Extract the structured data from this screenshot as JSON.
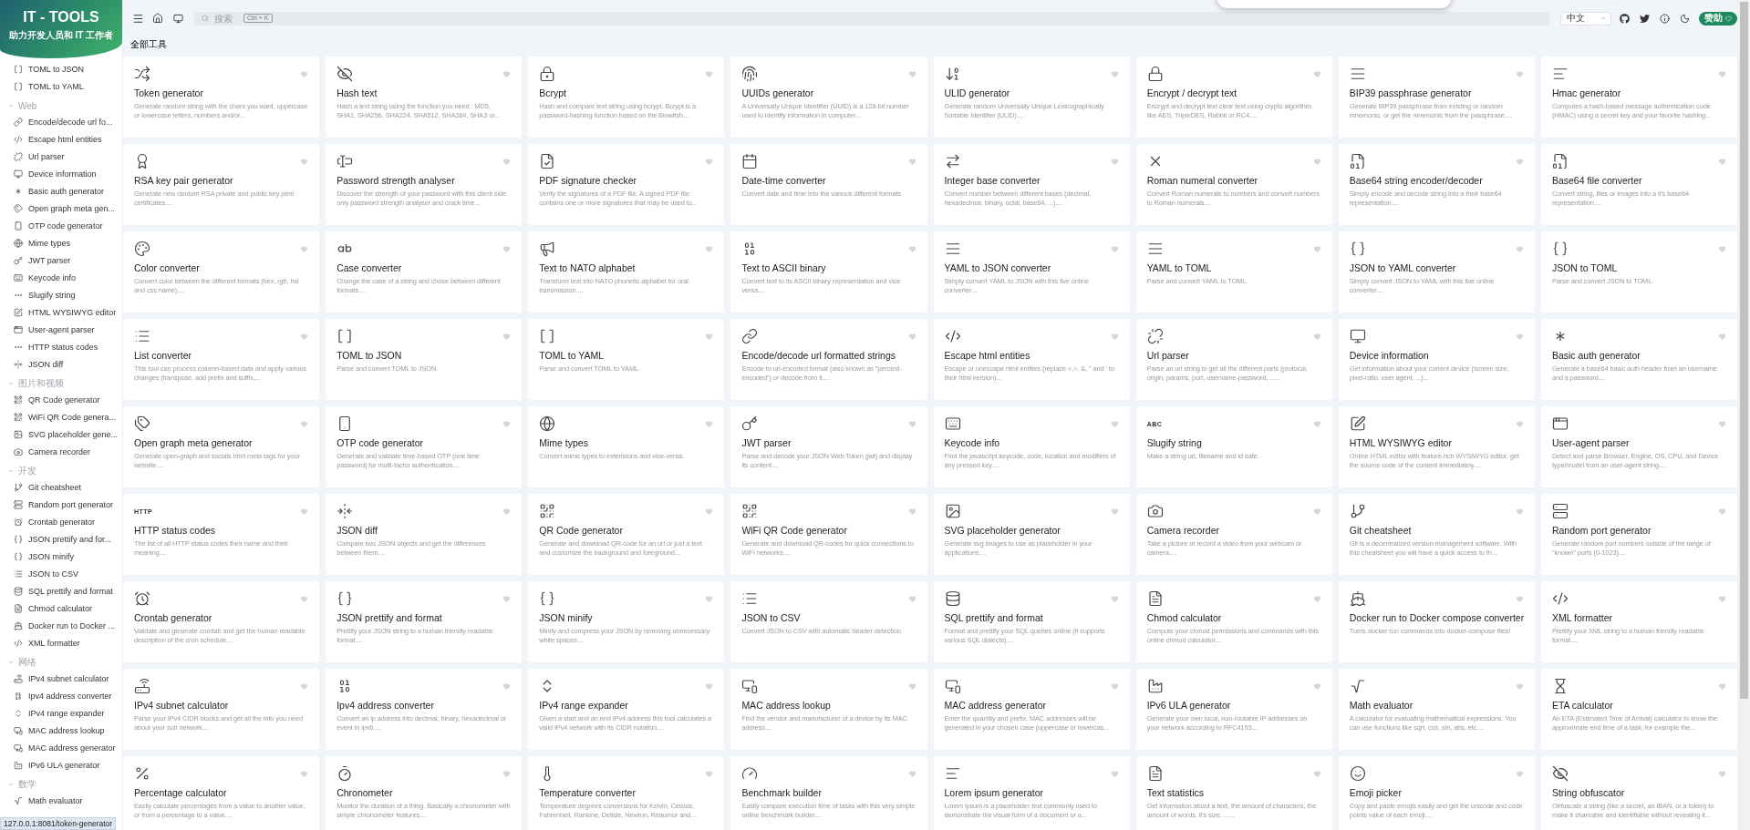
{
  "sidebar": {
    "logo": {
      "title": "IT - TOOLS",
      "subtitle": "助力开发人员和 IT 工作者"
    },
    "groups": [
      {
        "items": [
          "TOML to JSON",
          "TOML to YAML"
        ]
      },
      {
        "label": "Web",
        "expanded": true,
        "items": [
          "Encode/decode url fo...",
          "Escape html entities",
          "Url parser",
          "Device information",
          "Basic auth generator",
          "Open graph meta gen...",
          "OTP code generator",
          "Mime types",
          "JWT parser",
          "Keycode info",
          "Slugify string",
          "HTML WYSIWYG editor",
          "User-agent parser",
          "HTTP status codes",
          "JSON diff"
        ]
      },
      {
        "label": "图片和视频",
        "expanded": true,
        "items": [
          "QR Code generator",
          "WiFi QR Code genera...",
          "SVG placeholder gene...",
          "Camera recorder"
        ]
      },
      {
        "label": "开发",
        "expanded": true,
        "items": [
          "Git cheatsheet",
          "Random port generator",
          "Crontab generator",
          "JSON prettify and for...",
          "JSON minify",
          "JSON to CSV",
          "SQL prettify and format",
          "Chmod calculator",
          "Docker run to Docker ...",
          "XML formatter"
        ]
      },
      {
        "label": "网络",
        "expanded": true,
        "items": [
          "IPv4 subnet calculator",
          "Ipv4 address converter",
          "IPv4 range expander",
          "MAC address lookup",
          "MAC address generator",
          "IPv6 ULA generator"
        ]
      },
      {
        "label": "数学",
        "expanded": true,
        "items": [
          "Math evaluator"
        ]
      }
    ]
  },
  "topbar": {
    "search": {
      "placeholder": "搜索",
      "shortcut": "Ctrl + K"
    },
    "language": "中文",
    "sponsor": "赞助"
  },
  "section_title": "全部工具",
  "cards": [
    {
      "title": "Token generator",
      "description": "Generate random string with the chars you want, uppercase or lowercase letters, numbers and/or..."
    },
    {
      "title": "Hash text",
      "description": "Hash a text string using the function you need : MD5, SHA1, SHA256, SHA224, SHA512, SHA384, SHA3 or..."
    },
    {
      "title": "Bcrypt",
      "description": "Hash and compare text string using bcrypt. Bcrypt is a password-hashing function based on the Blowfish..."
    },
    {
      "title": "UUIDs generator",
      "description": "A Universally Unique Identifier (UUID) is a 128-bit number used to identify information in computer..."
    },
    {
      "title": "ULID generator",
      "description": "Generate random Universally Unique Lexicographically Sortable Identifier (ULID)...."
    },
    {
      "title": "Encrypt / decrypt text",
      "description": "Encrypt and decrypt text clear text using crypto algorithm like AES, TripleDES, Rabbit or RC4...."
    },
    {
      "title": "BIP39 passphrase generator",
      "description": "Generate BIP39 passphrase from existing or random mnemonic, or get the mnemonic from the passphrase...."
    },
    {
      "title": "Hmac generator",
      "description": "Computes a hash-based message authentication code (HMAC) using a secret key and your favorite hashing..."
    },
    {
      "title": "RSA key pair generator",
      "description": "Generate new random RSA private and public key pem certificates...."
    },
    {
      "title": "Password strength analyser",
      "description": "Discover the strength of your password with this client side only password strength analyser and crack time..."
    },
    {
      "title": "PDF signature checker",
      "description": "Verify the signatures of a PDF file. A signed PDF file contains one or more signatures that may be used to..."
    },
    {
      "title": "Date-time converter",
      "description": "Convert date and time into the various different formats"
    },
    {
      "title": "Integer base converter",
      "description": "Convert number between different bases (decimal, hexadecimal, binary, octal, base64, ...)...."
    },
    {
      "title": "Roman numeral converter",
      "description": "Convert Roman numerals to numbers and convert numbers to Roman numerals...."
    },
    {
      "title": "Base64 string encoder/decoder",
      "description": "Simply encode and decode string into a their base64 representation...."
    },
    {
      "title": "Base64 file converter",
      "description": "Convert string, files or images into a it's base64 representation...."
    },
    {
      "title": "Color converter",
      "description": "Convert color between the different formats (hex, rgb, hsl and css name)...."
    },
    {
      "title": "Case converter",
      "description": "Change the case of a string and chose between different formats...."
    },
    {
      "title": "Text to NATO alphabet",
      "description": "Transform text into NATO phonetic alphabet for oral transmission...."
    },
    {
      "title": "Text to ASCII binary",
      "description": "Convert text to its ASCII binary representation and vice versa...."
    },
    {
      "title": "YAML to JSON converter",
      "description": "Simply convert YAML to JSON with this live online converter...."
    },
    {
      "title": "YAML to TOML",
      "description": "Parse and convert YAML to TOML."
    },
    {
      "title": "JSON to YAML converter",
      "description": "Simply convert JSON to YAML with this live online converter...."
    },
    {
      "title": "JSON to TOML",
      "description": "Parse and convert JSON to TOML."
    },
    {
      "title": "List converter",
      "description": "This tool can process column-based data and apply various changes (transpose, add prefix and suffix,..."
    },
    {
      "title": "TOML to JSON",
      "description": "Parse and convert TOML to JSON."
    },
    {
      "title": "TOML to YAML",
      "description": "Parse and convert TOML to YAML."
    },
    {
      "title": "Encode/decode url formatted strings",
      "description": "Encode to url-encoded format (also known as \"percent-encoded\") or decode from it...."
    },
    {
      "title": "Escape html entities",
      "description": "Escape or unescape html entities (replace <,>, &, \" and ' to their html version)..."
    },
    {
      "title": "Url parser",
      "description": "Parse an url string to get all the different parts (protocol, origin, params, port, username-password, ......"
    },
    {
      "title": "Device information",
      "description": "Get information about your current device (screen size, pixel-ratio, user agent, ...)..."
    },
    {
      "title": "Basic auth generator",
      "description": "Generate a base64 basic auth header from an username and a password...."
    },
    {
      "title": "Open graph meta generator",
      "description": "Generate open-graph and socials html meta tags for your website...."
    },
    {
      "title": "OTP code generator",
      "description": "Generate and validate time-based OTP (one time password) for multi-factor authentication...."
    },
    {
      "title": "Mime types",
      "description": "Convert mime types to extensions and vice-versa."
    },
    {
      "title": "JWT parser",
      "description": "Parse and decode your JSON Web Token (jwt) and display its content...."
    },
    {
      "title": "Keycode info",
      "description": "Find the javascript keycode, code, location and modifiers of any pressed key...."
    },
    {
      "title": "Slugify string",
      "description": "Make a string url, filename and id safe.",
      "icon_text": "ABC"
    },
    {
      "title": "HTML WYSIWYG editor",
      "description": "Online HTML editor with feature-rich WYSIWYG editor, get the source code of the content immediately...."
    },
    {
      "title": "User-agent parser",
      "description": "Detect and parse Browser, Engine, OS, CPU, and Device type/model from an user-agent string...."
    },
    {
      "title": "HTTP status codes",
      "description": "The list of all HTTP status codes their name and their meaning....",
      "icon_text": "HTTP"
    },
    {
      "title": "JSON diff",
      "description": "Compare two JSON objects and get the differences between them...."
    },
    {
      "title": "QR Code generator",
      "description": "Generate and download QR-code for an url or just a text and customize the background and foreground..."
    },
    {
      "title": "WiFi QR Code generator",
      "description": "Generate and download QR-codes for quick connections to WiFi networks...."
    },
    {
      "title": "SVG placeholder generator",
      "description": "Generate svg images to use as placeholder in your applications...."
    },
    {
      "title": "Camera recorder",
      "description": "Take a picture or record a video from your webcam or camera...."
    },
    {
      "title": "Git cheatsheet",
      "description": "Git is a decentralized version management software. With this cheatsheet you will have a quick access to th..."
    },
    {
      "title": "Random port generator",
      "description": "Generate random port numbers outside of the range of \"known\" ports (0-1023)...."
    },
    {
      "title": "Crontab generator",
      "description": "Validate and generate crontab and get the human readable description of the cron schedule...."
    },
    {
      "title": "JSON prettify and format",
      "description": "Prettify your JSON string to a human friendly readable format...."
    },
    {
      "title": "JSON minify",
      "description": "Minify and compress your JSON by removing unnecessary white spaces...."
    },
    {
      "title": "JSON to CSV",
      "description": "Convert JSON to CSV with automatic header detection."
    },
    {
      "title": "SQL prettify and format",
      "description": "Format and prettify your SQL queries online (it supports various SQL dialects)...."
    },
    {
      "title": "Chmod calculator",
      "description": "Compute your chmod permissions and commands with this online chmod calculator...."
    },
    {
      "title": "Docker run to Docker compose converter",
      "description": "Turns docker run commands into docker-compose files!"
    },
    {
      "title": "XML formatter",
      "description": "Prettify your XML string to a human friendly readable format...."
    },
    {
      "title": "IPv4 subnet calculator",
      "description": "Parse your IPv4 CIDR blocks and get all the info you need about your sub network...."
    },
    {
      "title": "Ipv4 address converter",
      "description": "Convert an ip address into decimal, binary, hexadecimal or event in ipv6...."
    },
    {
      "title": "IPv4 range expander",
      "description": "Given a start and an end IPv4 address this tool calculates a valid IPv4 network with its CIDR notation...."
    },
    {
      "title": "MAC address lookup",
      "description": "Find the vendor and manufacturer of a device by its MAC address...."
    },
    {
      "title": "MAC address generator",
      "description": "Enter the quantity and prefix. MAC addresses will be generated in your chosen case (uppercase or lowercas..."
    },
    {
      "title": "IPv6 ULA generator",
      "description": "Generate your own local, non-routable IP addresses on your network according to RFC4193...."
    },
    {
      "title": "Math evaluator",
      "description": "A calculator for evaluating mathematical expressions. You can use functions like sqrt, cos, sin, abs, etc...."
    },
    {
      "title": "ETA calculator",
      "description": "An ETA (Estimated Time of Arrival) calculator to know the approximate end time of a task, for example the..."
    },
    {
      "title": "Percentage calculator",
      "description": "Easily calculate percentages from a value to another value, or from a percentage to a value...."
    },
    {
      "title": "Chronometer",
      "description": "Monitor the duration of a thing. Basically a chronometer with simple chronometer features...."
    },
    {
      "title": "Temperature converter",
      "description": "Temperature degrees conversions for Kelvin, Celsius, Fahrenheit, Rankine, Delisle, Newton, Réaumur and..."
    },
    {
      "title": "Benchmark builder",
      "description": "Easily compare execution time of tasks with this very simple online benchmark builder...."
    },
    {
      "title": "Lorem ipsum generator",
      "description": "Lorem ipsum is a placeholder text commonly used to demonstrate the visual form of a document or a..."
    },
    {
      "title": "Text statistics",
      "description": "Get information about a text, the amount of characters, the amount of words, it's size, ......"
    },
    {
      "title": "Emoji picker",
      "description": "Copy and paste emojis easily and get the unicode and code points value of each emoji...."
    },
    {
      "title": "String obfuscator",
      "description": "Obfuscate a string (like a secret, an IBAN, or a token) to make it shareable and identifiable without revealing it..."
    }
  ],
  "status_url": "127.0.0.1:8081/token-generator"
}
